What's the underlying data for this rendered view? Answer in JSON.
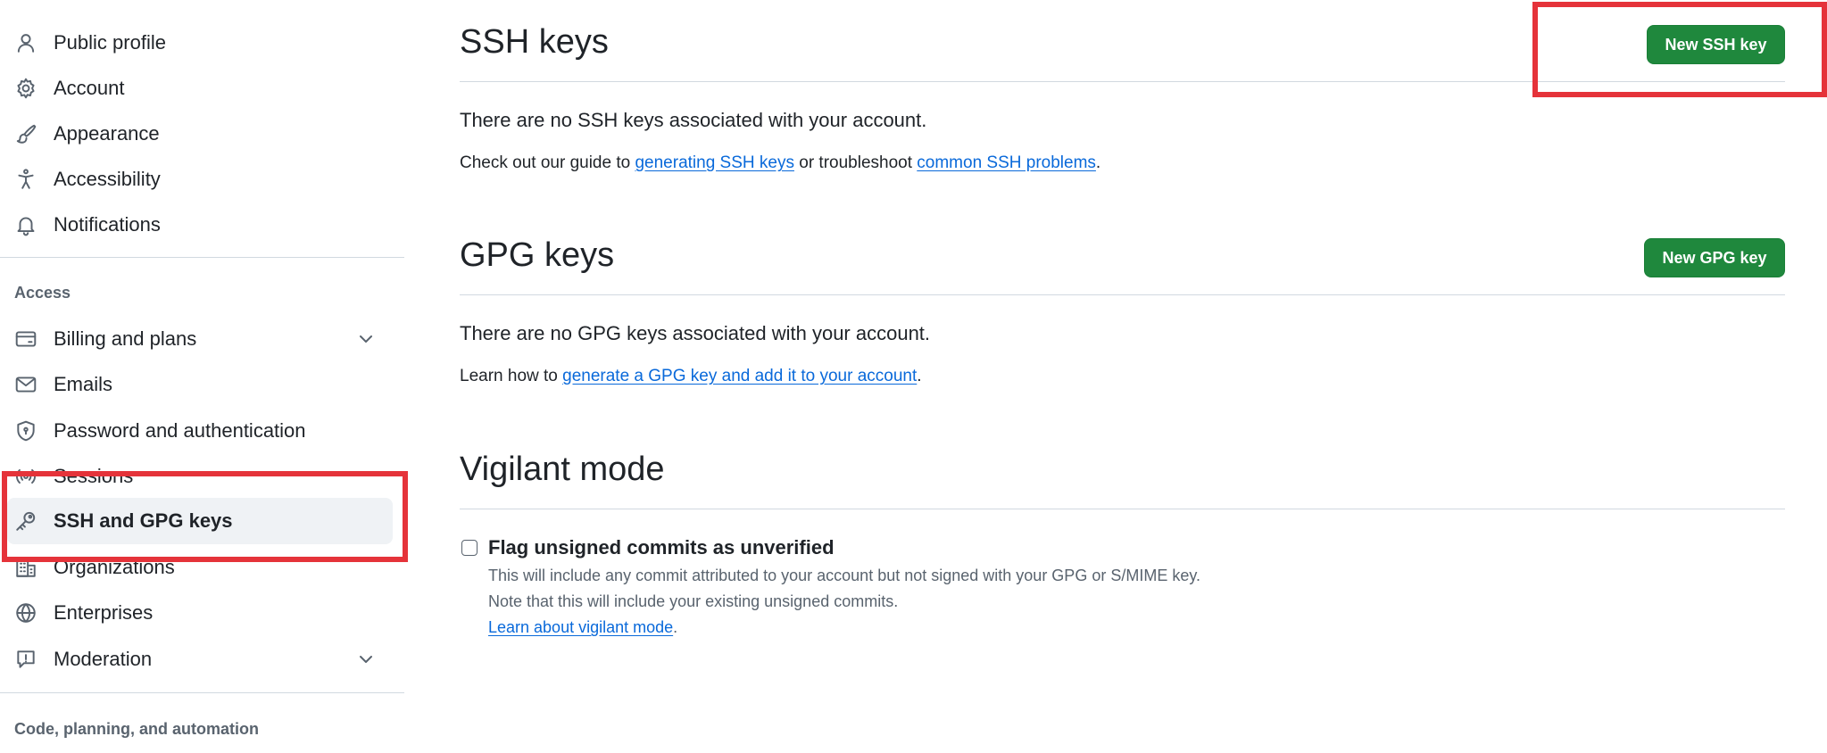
{
  "sidebar": {
    "items": [
      {
        "label": "Public profile",
        "icon": "person-icon"
      },
      {
        "label": "Account",
        "icon": "gear-icon"
      },
      {
        "label": "Appearance",
        "icon": "paintbrush-icon"
      },
      {
        "label": "Accessibility",
        "icon": "accessibility-icon"
      },
      {
        "label": "Notifications",
        "icon": "bell-icon"
      }
    ],
    "access_heading": "Access",
    "access_items": [
      {
        "label": "Billing and plans",
        "icon": "credit-card-icon",
        "expandable": true
      },
      {
        "label": "Emails",
        "icon": "mail-icon"
      },
      {
        "label": "Password and authentication",
        "icon": "shield-lock-icon"
      },
      {
        "label": "Sessions",
        "icon": "broadcast-icon"
      },
      {
        "label": "SSH and GPG keys",
        "icon": "key-icon",
        "selected": true
      },
      {
        "label": "Organizations",
        "icon": "organization-icon"
      },
      {
        "label": "Enterprises",
        "icon": "globe-icon"
      },
      {
        "label": "Moderation",
        "icon": "report-icon",
        "expandable": true
      }
    ],
    "code_heading": "Code, planning, and automation"
  },
  "ssh": {
    "title": "SSH keys",
    "button": "New SSH key",
    "empty": "There are no SSH keys associated with your account.",
    "guide_pre": "Check out our guide to ",
    "guide_link1": "generating SSH keys",
    "guide_mid": " or troubleshoot ",
    "guide_link2": "common SSH problems",
    "guide_post": "."
  },
  "gpg": {
    "title": "GPG keys",
    "button": "New GPG key",
    "empty": "There are no GPG keys associated with your account.",
    "learn_pre": "Learn how to ",
    "learn_link": "generate a GPG key and add it to your account",
    "learn_post": "."
  },
  "vigilant": {
    "title": "Vigilant mode",
    "checkbox_label": "Flag unsigned commits as unverified",
    "checked": false,
    "desc1": "This will include any commit attributed to your account but not signed with your GPG or S/MIME key.",
    "desc2": "Note that this will include your existing unsigned commits.",
    "link": "Learn about vigilant mode",
    "link_post": "."
  },
  "colors": {
    "primary_button": "#1f883d",
    "link": "#0969da",
    "annotation": "#e5333a",
    "selected_bg": "#eff2f5"
  }
}
